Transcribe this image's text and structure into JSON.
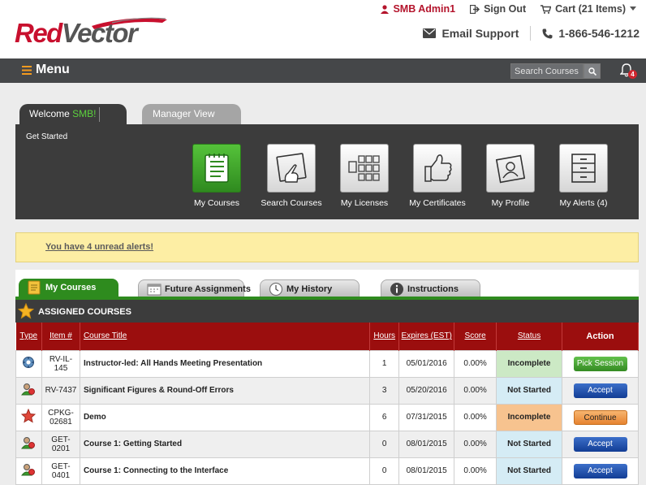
{
  "brand": {
    "logo_red": "Red",
    "logo_gray": "Vector"
  },
  "topbar": {
    "user": "SMB Admin1",
    "signout": "Sign Out",
    "cart": "Cart (21 Items)",
    "support": "Email Support",
    "phone": "1-866-546-1212"
  },
  "menubar": {
    "menu_label": "Menu",
    "search_placeholder": "Search Courses",
    "alert_count": "4"
  },
  "tabs": {
    "welcome_prefix": "Welcome ",
    "welcome_name": "SMB!",
    "manager": "Manager View"
  },
  "dashboard": {
    "get_started": "Get Started",
    "tiles": [
      {
        "label": "My Courses",
        "icon": "notepad-icon"
      },
      {
        "label": "Search Courses",
        "icon": "touch-screen-icon"
      },
      {
        "label": "My Licenses",
        "icon": "licenses-grid-icon"
      },
      {
        "label": "My Certificates",
        "icon": "thumbs-up-icon"
      },
      {
        "label": "My Profile",
        "icon": "profile-icon"
      },
      {
        "label": "My Alerts (4)",
        "icon": "cabinet-icon"
      }
    ]
  },
  "alert": {
    "text": "You have 4 unread alerts!"
  },
  "course_tabs": [
    "My Courses",
    "Future Assignments",
    "My History",
    "Instructions"
  ],
  "section_title": "ASSIGNED COURSES",
  "table": {
    "headers": {
      "type": "Type",
      "item": "Item #",
      "title": "Course Title",
      "hours": "Hours",
      "expires": "Expires (EST)",
      "score": "Score",
      "status": "Status",
      "action": "Action"
    },
    "rows": [
      {
        "item": "RV-IL-145",
        "title": "Instructor-led: All Hands Meeting Presentation",
        "hours": "1",
        "expires": "05/01/2016",
        "score": "0.00%",
        "status": "Incomplete",
        "action": "Pick Session"
      },
      {
        "item": "RV-7437",
        "title": "Significant Figures & Round-Off Errors",
        "hours": "3",
        "expires": "05/20/2016",
        "score": "0.00%",
        "status": "Not Started",
        "action": "Accept"
      },
      {
        "item": "CPKG-02681",
        "title": "Demo",
        "hours": "6",
        "expires": "07/31/2015",
        "score": "0.00%",
        "status": "Incomplete",
        "action": "Continue"
      },
      {
        "item": "GET-0201",
        "title": "Course 1: Getting Started",
        "hours": "0",
        "expires": "08/01/2015",
        "score": "0.00%",
        "status": "Not Started",
        "action": "Accept"
      },
      {
        "item": "GET-0401",
        "title": "Course 1: Connecting to the Interface",
        "hours": "0",
        "expires": "08/01/2015",
        "score": "0.00%",
        "status": "Not Started",
        "action": "Accept"
      }
    ]
  },
  "colors": {
    "brand_red": "#c8102e",
    "header_dark": "#454749",
    "table_head": "#9b0e0e",
    "tab_green": "#2e8b1e"
  }
}
